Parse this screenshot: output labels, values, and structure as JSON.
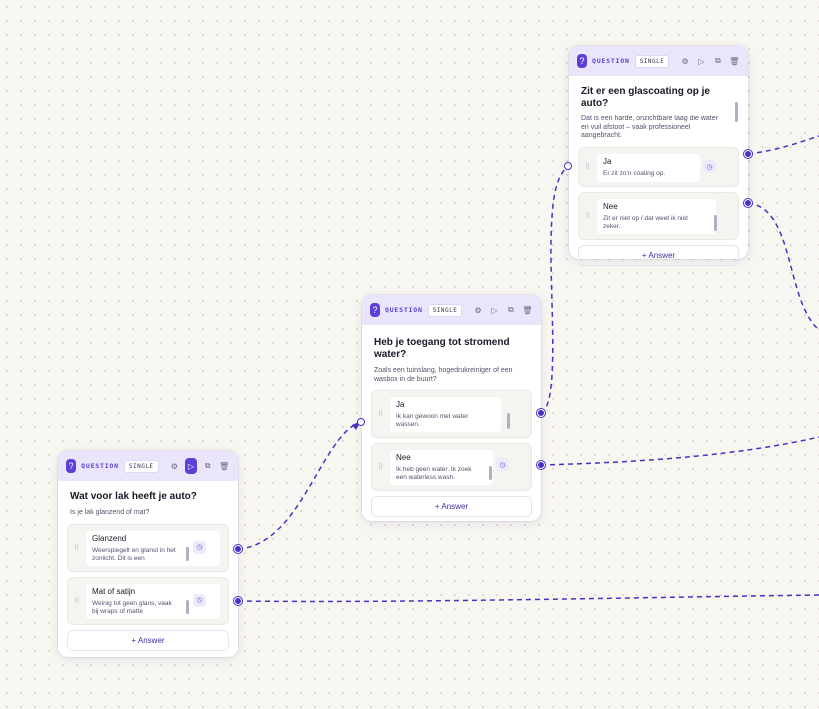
{
  "theme": {
    "accent": "#5b3fd6",
    "edge": "#4b2fc7",
    "header_bg": "#eae5fb",
    "canvas_bg": "#f8f6f1"
  },
  "nodes": [
    {
      "type_label": "QUESTION",
      "mode": "SINGLE",
      "title": "Wat voor lak heeft je auto?",
      "description": "Is je lak glanzend of mat?",
      "answers": [
        {
          "label": "Glanzend",
          "description": "Weerspiegelt en glanst in het zonlicht. Dit is een"
        },
        {
          "label": "Mat of satijn",
          "description": "Weinig tot geen glans, vaak bij wraps of matte"
        }
      ],
      "add_answer_label": "Answer"
    },
    {
      "type_label": "QUESTION",
      "mode": "SINGLE",
      "title": "Heb je toegang tot stromend water?",
      "description": "Zoals een tuinslang, hogedrukreiniger of een wasbox in de buurt?",
      "answers": [
        {
          "label": "Ja",
          "description": "Ik kan gewoon met water wassen."
        },
        {
          "label": "Nee",
          "description": "Ik heb geen water. Ik zoek een waterless wash."
        }
      ],
      "add_answer_label": "Answer"
    },
    {
      "type_label": "QUESTION",
      "mode": "SINGLE",
      "title": "Zit er een glascoating op je auto?",
      "description": "Dat is een harde, onzichtbare laag die water en vuil afstoot – vaak professioneel aangebracht.",
      "answers": [
        {
          "label": "Ja",
          "description": "Er zit zo’n coating op."
        },
        {
          "label": "Nee",
          "description": "Zit er niet op / dat weet ik niet zeker."
        }
      ],
      "add_answer_label": "Answer"
    }
  ]
}
